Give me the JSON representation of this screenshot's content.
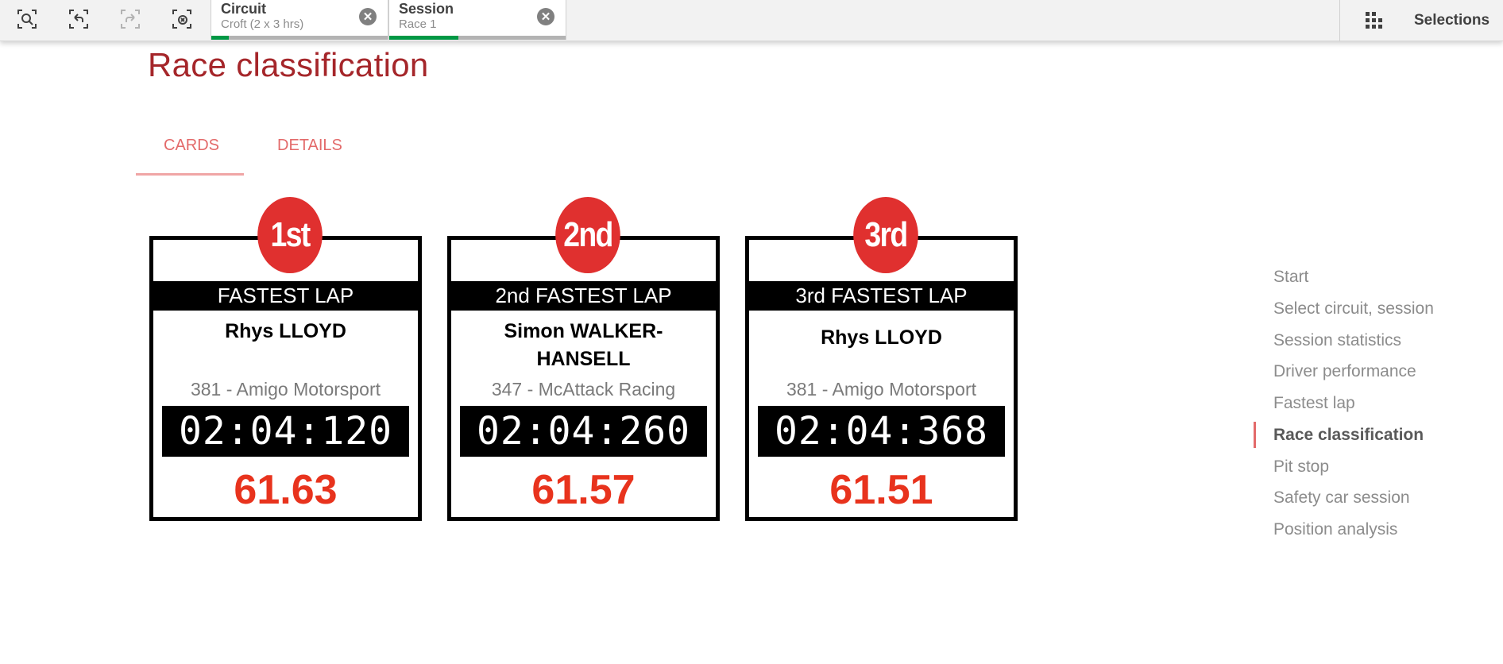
{
  "toolbar": {
    "tools": [
      {
        "icon": "smart-search-icon"
      },
      {
        "icon": "step-back-icon"
      },
      {
        "icon": "step-forward-icon"
      },
      {
        "icon": "clear-selections-icon"
      }
    ],
    "chips": [
      {
        "field": "Circuit",
        "value": "Croft (2 x 3 hrs)",
        "progress": 0.1
      },
      {
        "field": "Session",
        "value": "Race 1",
        "progress": 0.39
      }
    ],
    "selections_label": "Selections",
    "selections_icon": "selections-grid-icon",
    "progress_color": "#009845"
  },
  "page": {
    "title": "Race classification",
    "title_color": "#a5262a"
  },
  "tabs": [
    {
      "label": "CARDS",
      "active": true
    },
    {
      "label": "DETAILS",
      "active": false
    }
  ],
  "cards": [
    {
      "position": "1st",
      "banner": "FASTEST LAP",
      "driver": "Rhys LLOYD",
      "team": "381 - Amigo Motorsport",
      "lap_time": "02:04:120",
      "speed": "61.63"
    },
    {
      "position": "2nd",
      "banner": "2nd FASTEST LAP",
      "driver": "Simon WALKER-HANSELL",
      "team": "347 - McAttack Racing",
      "lap_time": "02:04:260",
      "speed": "61.57"
    },
    {
      "position": "3rd",
      "banner": "3rd FASTEST LAP",
      "driver": "Rhys LLOYD",
      "team": "381 - Amigo Motorsport",
      "lap_time": "02:04:368",
      "speed": "61.51"
    }
  ],
  "colors": {
    "badge": "#e0302f",
    "speed": "#e8331d",
    "accent": "#e36a6a"
  },
  "nav": {
    "items": [
      {
        "label": "Start"
      },
      {
        "label": "Select circuit, session"
      },
      {
        "label": "Session statistics"
      },
      {
        "label": "Driver performance"
      },
      {
        "label": "Fastest lap"
      },
      {
        "label": "Race classification",
        "active": true
      },
      {
        "label": "Pit stop"
      },
      {
        "label": "Safety car session"
      },
      {
        "label": "Position analysis"
      }
    ]
  }
}
